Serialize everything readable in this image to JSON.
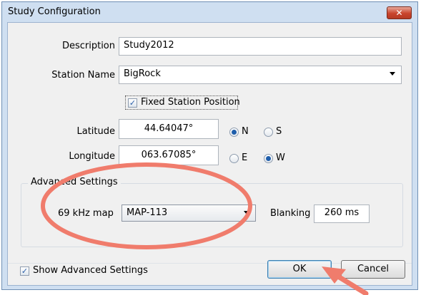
{
  "window": {
    "title": "Study Configuration",
    "close_label": "✕"
  },
  "form": {
    "description_label": "Description",
    "description_value": "Study2012",
    "station_label": "Station Name",
    "station_value": "BigRock",
    "fixed_position_label": "Fixed Station Position",
    "fixed_position_checked": true,
    "latitude_label": "Latitude",
    "latitude_value": "44.64047°",
    "lat_n_label": "N",
    "lat_s_label": "S",
    "lat_selected": "N",
    "longitude_label": "Longitude",
    "longitude_value": "063.67085°",
    "lon_e_label": "E",
    "lon_w_label": "W",
    "lon_selected": "W"
  },
  "advanced": {
    "group_title": "Advanced Settings",
    "map_label": "69 kHz map",
    "map_value": "MAP-113",
    "blanking_label": "Blanking",
    "blanking_value": "260 ms"
  },
  "footer": {
    "show_advanced_label": "Show Advanced Settings",
    "show_advanced_checked": true,
    "ok_label": "OK",
    "cancel_label": "Cancel"
  },
  "colors": {
    "annotation": "#f07c6c",
    "titlebar": "#cfdff1",
    "dialog_bg": "#f0f0f0"
  }
}
